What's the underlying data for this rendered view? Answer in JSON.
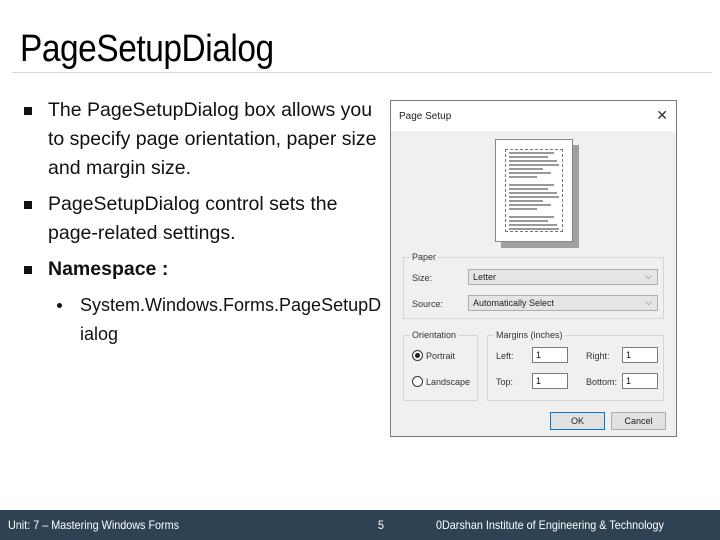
{
  "slide": {
    "title": "PageSetupDialog",
    "bullets": [
      "The PageSetupDialog box allows you to specify page orientation, paper size and margin size.",
      "PageSetupDialog control sets the page-related settings.",
      "Namespace :"
    ],
    "sub_bullets": [
      "System.Windows.Forms.PageSetupDialog"
    ]
  },
  "dialog": {
    "title": "Page Setup",
    "close_icon": "close-icon",
    "paper": {
      "group_label": "Paper",
      "size_label": "Size:",
      "size_value": "Letter",
      "source_label": "Source:",
      "source_value": "Automatically Select"
    },
    "orientation": {
      "group_label": "Orientation",
      "portrait_label": "Portrait",
      "landscape_label": "Landscape",
      "selected": "Portrait"
    },
    "margins": {
      "group_label": "Margins (inches)",
      "left_label": "Left:",
      "left_value": "1",
      "right_label": "Right:",
      "right_value": "1",
      "top_label": "Top:",
      "top_value": "1",
      "bottom_label": "Bottom:",
      "bottom_value": "1"
    },
    "ok_label": "OK",
    "cancel_label": "Cancel"
  },
  "footer": {
    "unit": "Unit: 7 – Mastering Windows Forms",
    "page_number": "5",
    "institute": "0Darshan Institute of Engineering & Technology"
  },
  "colors": {
    "footer_bg": "#2f4254",
    "ok_border": "#0078d7"
  }
}
